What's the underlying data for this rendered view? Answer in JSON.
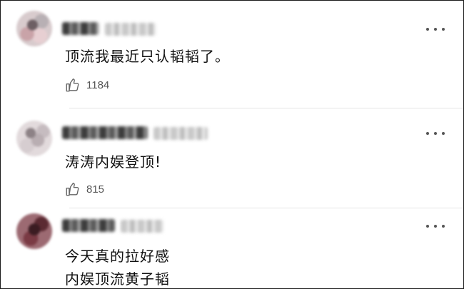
{
  "comments": [
    {
      "text": "顶流我最近只认韬韬了。",
      "likes": "1184",
      "like_icon": "thumbs-up-icon",
      "more_icon": "more-icon"
    },
    {
      "text": "涛涛内娱登顶!",
      "likes": "815",
      "like_icon": "thumbs-up-icon",
      "more_icon": "more-icon"
    },
    {
      "text_line1": "今天真的拉好感",
      "text_line2": "内娱顶流黄子韬",
      "more_icon": "more-icon"
    }
  ]
}
